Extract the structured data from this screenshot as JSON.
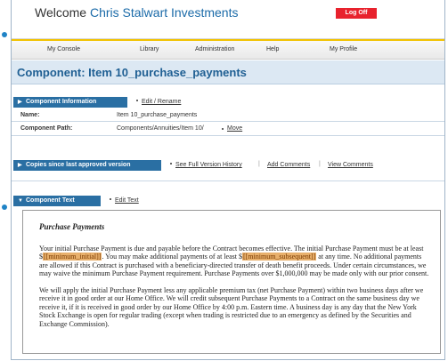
{
  "header": {
    "welcome": "Welcome",
    "user": "Chris Stalwart Investments",
    "logoff": "Log Off"
  },
  "nav": [
    "My Console",
    "Library",
    "Administration",
    "Help",
    "My Profile"
  ],
  "page_title": "Component: Item 10_purchase_payments",
  "component_info": {
    "title": "Component Information",
    "edit_link": "Edit / Rename",
    "name_label": "Name:",
    "name_value": "Item 10_purchase_payments",
    "path_label": "Component Path:",
    "path_value": "Components/Annuities/Item 10/",
    "move_link": "Move"
  },
  "copies": {
    "title": "Copies since last approved version",
    "history_link": "See Full Version History",
    "add_comments_link": "Add Comments",
    "view_comments_link": "View Comments",
    "separator": "|"
  },
  "component_text": {
    "title": "Component Text",
    "edit_link": "Edit Text",
    "heading": "Purchase Payments",
    "p1_a": "Your initial Purchase Payment is due and payable before the Contract becomes effective. The initial Purchase Payment must be at least $",
    "p1_var1": "[[minimum_initial]]",
    "p1_b": ". You may make additional payments of at least $",
    "p1_var2": "[[minimum_subsequent]]",
    "p1_c": " at any time. No additional payments are allowed if this Contract is purchased with a beneficiary-directed transfer of death benefit proceeds. Under certain circumstances, we may waive the minimum Purchase Payment requirement. Purchase Payments over $1,000,000 may be made only with our prior consent.",
    "p2": "We will apply the initial Purchase Payment less any applicable premium tax (net Purchase Payment) within two business days after we receive it in good order at our Home Office. We will credit subsequent Purchase Payments to a Contract on the same business day we receive it, if it is received in good order by our Home Office by 4:00 p.m. Eastern time. A business day is any day that the New York Stock Exchange is open for regular trading (except when trading is restricted due to an emergency as defined by the Securities and Exchange Commission)."
  },
  "colors": {
    "accent": "#2a6fa3",
    "title_bg": "#dce8f3",
    "logoff": "#e8222d",
    "highlight": "#e8b06c"
  }
}
